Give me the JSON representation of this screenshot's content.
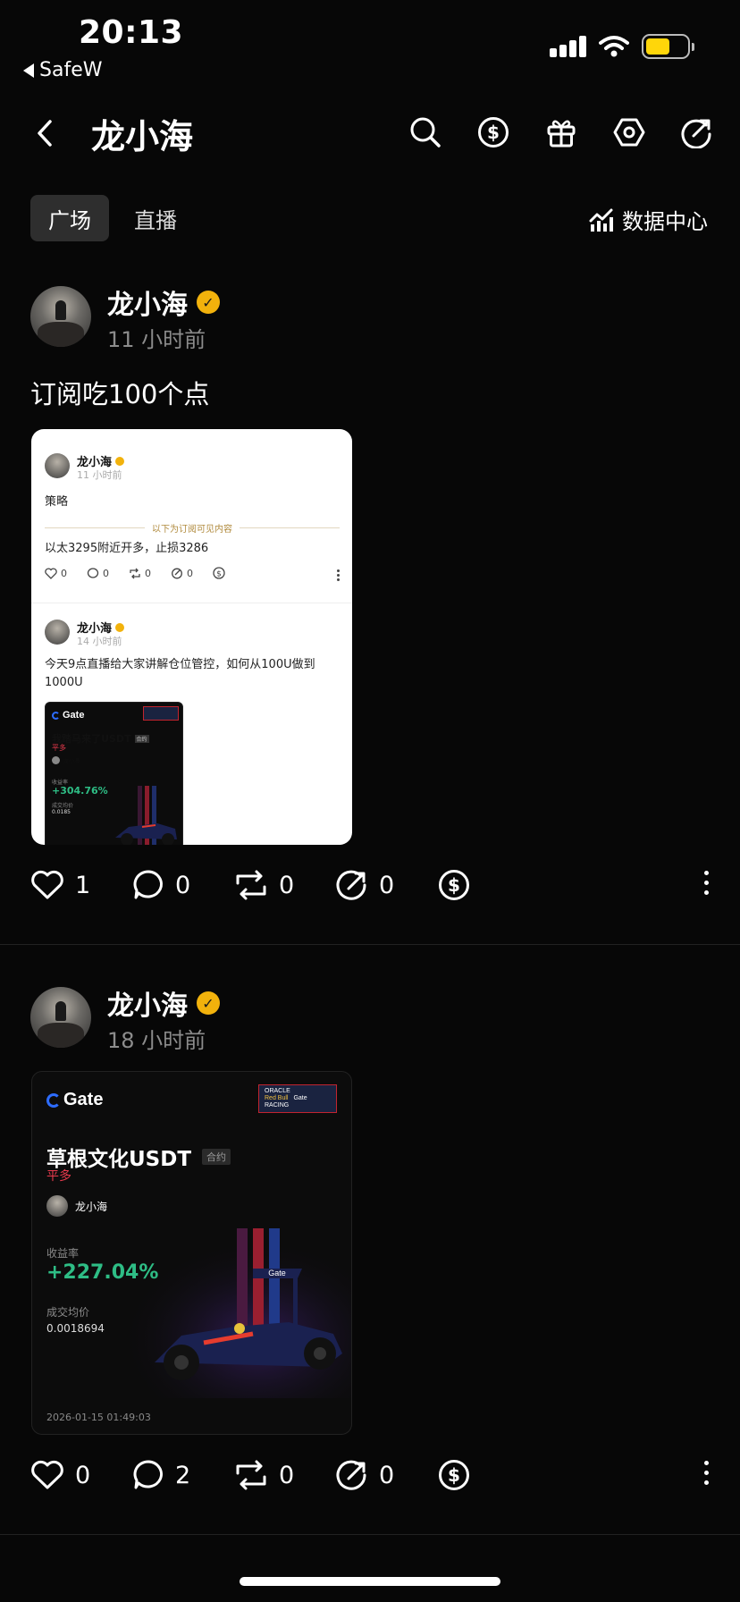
{
  "status_bar": {
    "time": "20:13",
    "back_app": "SafeW",
    "battery_color": "#ffd60a"
  },
  "header": {
    "back_icon": "chevron-left-icon",
    "title": "龙小海",
    "icons": [
      "search-icon",
      "dollar-coin-icon",
      "gift-icon",
      "settings-hex-icon",
      "share-icon"
    ]
  },
  "tabs": [
    {
      "label": "广场",
      "active": true
    },
    {
      "label": "直播",
      "active": false
    }
  ],
  "data_center": {
    "label": "数据中心",
    "icon": "analytics-chart-icon"
  },
  "posts": [
    {
      "author": "龙小海",
      "verified": true,
      "time": "11 小时前",
      "text": "订阅吃100个点",
      "embedded_screenshot": {
        "post1": {
          "author": "龙小海",
          "time": "11 小时前",
          "text": "策略",
          "subscription_divider": "以下为订阅可见内容",
          "hidden_text": "以太3295附近开多，止损3286",
          "likes": "0",
          "comments": "0",
          "reposts": "0",
          "shares": "0"
        },
        "post2": {
          "author": "龙小海",
          "time": "14 小时前",
          "text": "今天9点直播给大家讲解仓位管控，如何从100U做到1000U",
          "card": {
            "brand": "Gate",
            "title": "我踏马来了USDT",
            "tag": "合约",
            "direction": "平多",
            "user": "龙小海",
            "return_label": "收益率",
            "return_value": "+304.76%",
            "price_label": "成交均价",
            "price_value": "0.0185"
          }
        }
      },
      "likes": "1",
      "comments": "0",
      "reposts": "0",
      "shares": "0"
    },
    {
      "author": "龙小海",
      "verified": true,
      "time": "18 小时前",
      "trade_card": {
        "brand": "Gate",
        "sponsor_top": "ORACLE",
        "sponsor_mid": "Red Bull",
        "sponsor_right": "Gate",
        "sponsor_bottom": "RACING",
        "title": "草根文化USDT",
        "tag": "合约",
        "direction": "平多",
        "user": "龙小海",
        "return_label": "收益率",
        "return_value": "+227.04%",
        "price_label": "成交均价",
        "price_value": "0.0018694",
        "timestamp": "2026-01-15 01:49:03"
      },
      "likes": "0",
      "comments": "2",
      "reposts": "0",
      "shares": "0"
    }
  ],
  "colors": {
    "positive": "#2ebd85",
    "negative": "#e83a4d",
    "verified": "#f2b20c"
  }
}
